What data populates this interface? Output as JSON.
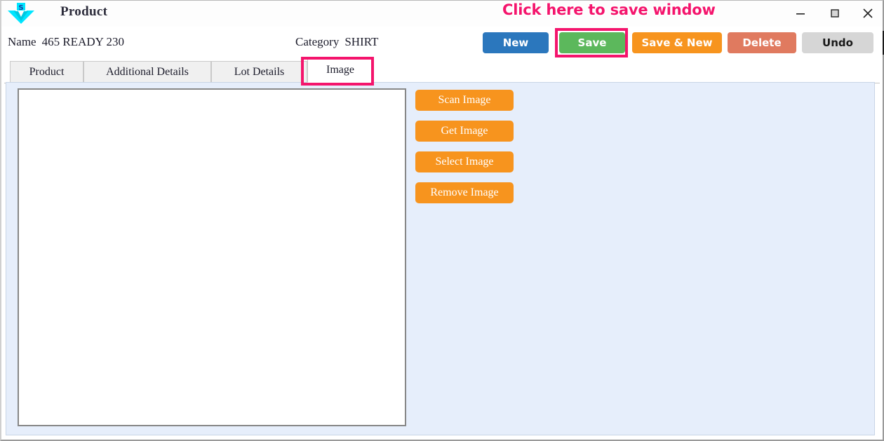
{
  "window": {
    "title": "Product",
    "logo_icon": "company-logo-icon",
    "controls": {
      "minimize_icon": "minimize-icon",
      "maximize_icon": "maximize-icon",
      "close_icon": "close-icon"
    }
  },
  "annotation": {
    "callout": "Click here to save window",
    "highlight_color": "#f4146c"
  },
  "fields": {
    "name_label": "Name",
    "name_value": "465 READY 230",
    "category_label": "Category",
    "category_value": "SHIRT"
  },
  "toolbar": {
    "new_label": "New",
    "save_label": "Save",
    "save_new_label": "Save & New",
    "delete_label": "Delete",
    "undo_label": "Undo",
    "more_icon": "vertical-ellipsis-icon",
    "colors": {
      "new": "#2b77bd",
      "save": "#5cb85c",
      "save_new": "#f7941e",
      "delete": "#e07a5f",
      "undo": "#d6d6d6"
    }
  },
  "tabs": [
    {
      "id": "product",
      "label": "Product",
      "active": false
    },
    {
      "id": "additional",
      "label": "Additional Details",
      "active": false
    },
    {
      "id": "lot",
      "label": "Lot Details",
      "active": false
    },
    {
      "id": "image",
      "label": "Image",
      "active": true
    }
  ],
  "image_tab": {
    "preview_placeholder": "",
    "buttons": [
      {
        "id": "scan",
        "label": "Scan Image"
      },
      {
        "id": "get",
        "label": "Get Image"
      },
      {
        "id": "select",
        "label": "Select Image"
      },
      {
        "id": "remove",
        "label": "Remove Image"
      }
    ],
    "accent_color": "#f7941e",
    "panel_background": "#e6eefb"
  }
}
